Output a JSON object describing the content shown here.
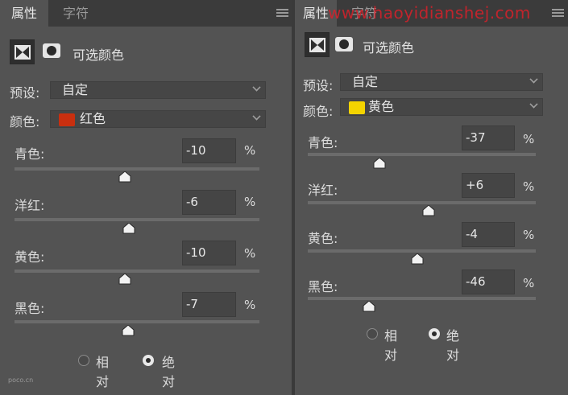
{
  "left": {
    "tabs": [
      "属性",
      "字符"
    ],
    "title": "可选颜色",
    "preset_label": "预设:",
    "preset_value": "自定",
    "color_label": "颜色:",
    "color_value": "红色",
    "color_swatch": "#c92f0f",
    "sliders": [
      {
        "label": "青色:",
        "value": "-10",
        "unit": "%"
      },
      {
        "label": "洋红:",
        "value": "-6",
        "unit": "%"
      },
      {
        "label": "黄色:",
        "value": "-10",
        "unit": "%"
      },
      {
        "label": "黑色:",
        "value": "-7",
        "unit": "%"
      }
    ],
    "radio_relative": "相对",
    "radio_absolute": "绝对",
    "selected_mode": "绝对"
  },
  "right": {
    "tabs": [
      "属性",
      "字符"
    ],
    "title": "可选颜色",
    "preset_label": "预设:",
    "preset_value": "自定",
    "color_label": "颜色:",
    "color_value": "黄色",
    "color_swatch": "#f4d400",
    "sliders": [
      {
        "label": "青色:",
        "value": "-37",
        "unit": "%"
      },
      {
        "label": "洋红:",
        "value": "+6",
        "unit": "%"
      },
      {
        "label": "黄色:",
        "value": "-4",
        "unit": "%"
      },
      {
        "label": "黑色:",
        "value": "-46",
        "unit": "%"
      }
    ],
    "radio_relative": "相对",
    "radio_absolute": "绝对",
    "selected_mode": "绝对"
  },
  "watermark": "www.haoyidianshej.com",
  "poco_mark": "poco.cn"
}
